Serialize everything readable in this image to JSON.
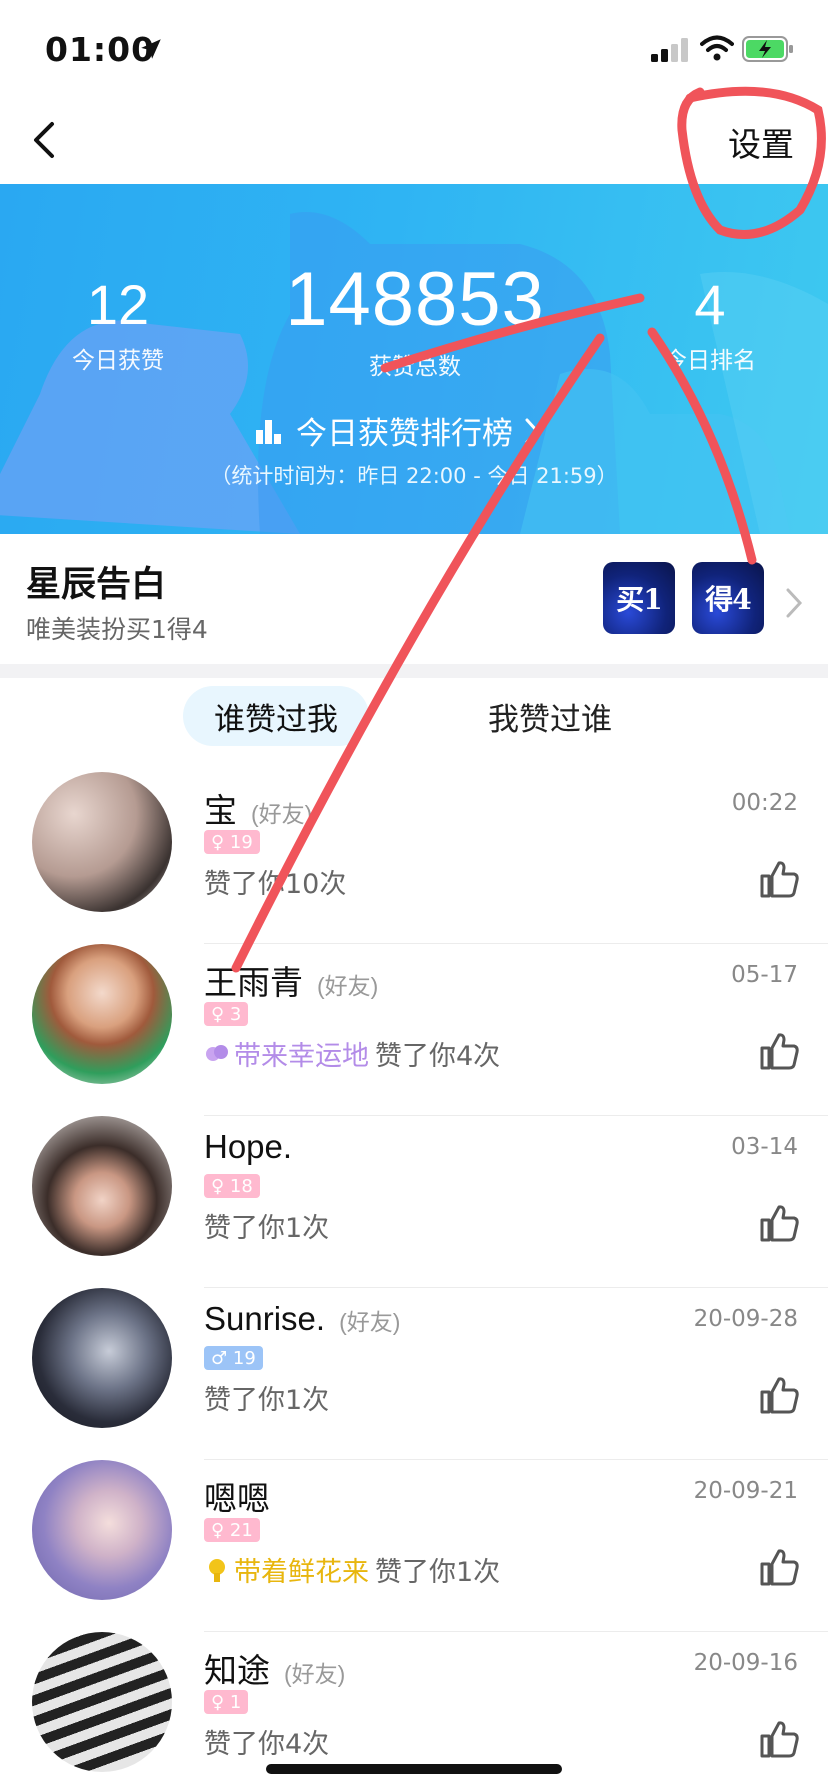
{
  "status_bar": {
    "time": "01:00"
  },
  "nav": {
    "settings_label": "设置"
  },
  "banner": {
    "today_likes": {
      "value": "12",
      "label": "今日获赞"
    },
    "total_likes": {
      "value": "148853",
      "label": "获赞总数"
    },
    "today_rank": {
      "value": "4",
      "label": "今日排名"
    },
    "rank_link_label": "今日获赞排行榜",
    "note": "（统计时间为：昨日 22:00 - 今日 21:59）"
  },
  "promo": {
    "title": "星辰告白",
    "subtitle": "唯美装扮买1得4",
    "badge_1": "买1",
    "badge_2": "得4"
  },
  "tabs": [
    {
      "label": "谁赞过我",
      "active": true
    },
    {
      "label": "我赞过谁",
      "active": false
    }
  ],
  "list": [
    {
      "name": "宝",
      "friend": "(好友)",
      "time": "00:22",
      "gender": "♀",
      "age": "19",
      "gift": "",
      "desc": "赞了你10次"
    },
    {
      "name": "王雨青",
      "friend": "(好友)",
      "time": "05-17",
      "gender": "♀",
      "age": "3",
      "gift": "带来幸运地",
      "desc": "赞了你4次"
    },
    {
      "name": "Hope.",
      "friend": "",
      "time": "03-14",
      "gender": "♀",
      "age": "18",
      "gift": "",
      "desc": "赞了你1次"
    },
    {
      "name": "Sunrise.",
      "friend": "(好友)",
      "time": "20-09-28",
      "gender": "♂",
      "age": "19",
      "gift": "",
      "desc": "赞了你1次"
    },
    {
      "name": "嗯嗯",
      "friend": "",
      "time": "20-09-21",
      "gender": "♀",
      "age": "21",
      "gift": "带着鲜花来",
      "desc": "赞了你1次"
    },
    {
      "name": "知途",
      "friend": "(好友)",
      "time": "20-09-16",
      "gender": "♀",
      "age": "1",
      "gift": "",
      "desc": "赞了你4次"
    }
  ],
  "colors": {
    "banner": "#2fb4f3",
    "tab_active_bg": "#e8f6fe",
    "female_badge": "#ffb9cf",
    "male_badge": "#9cc4f7",
    "gift_purple": "#b38ce8",
    "gift_yellow": "#e8b60e",
    "annotation_red": "#f0545a"
  },
  "icons": [
    "location-arrow-icon",
    "signal-icon",
    "wifi-icon",
    "battery-icon",
    "back-icon",
    "bar-chart-icon",
    "chevron-right-icon",
    "thumb-up-icon",
    "gift-icon"
  ]
}
